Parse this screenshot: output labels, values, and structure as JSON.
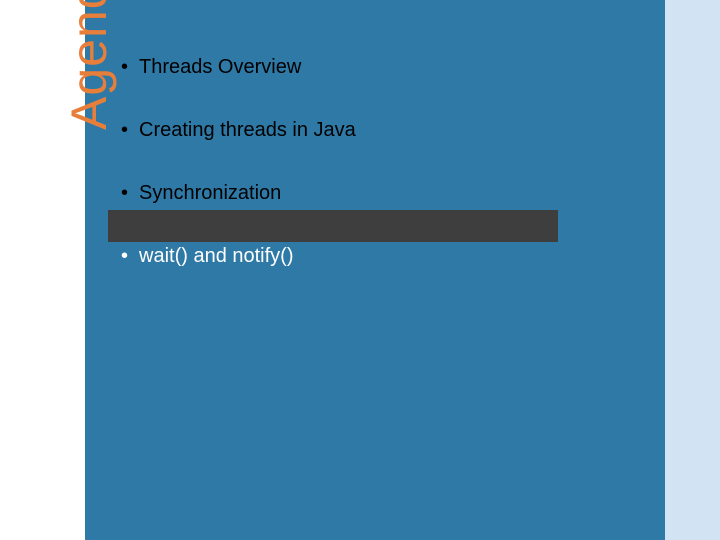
{
  "slide": {
    "title": "Agenda",
    "items": [
      {
        "text": "Threads Overview",
        "highlight": false
      },
      {
        "text": "Creating threads in Java",
        "highlight": false
      },
      {
        "text": "Synchronization",
        "highlight": false
      },
      {
        "text": "wait() and notify()",
        "highlight": true
      }
    ]
  },
  "colors": {
    "main_bg": "#2f79a6",
    "right_bg": "#d2e4f3",
    "title": "#e77e3a",
    "highlight_bar": "#3e3e3e"
  }
}
